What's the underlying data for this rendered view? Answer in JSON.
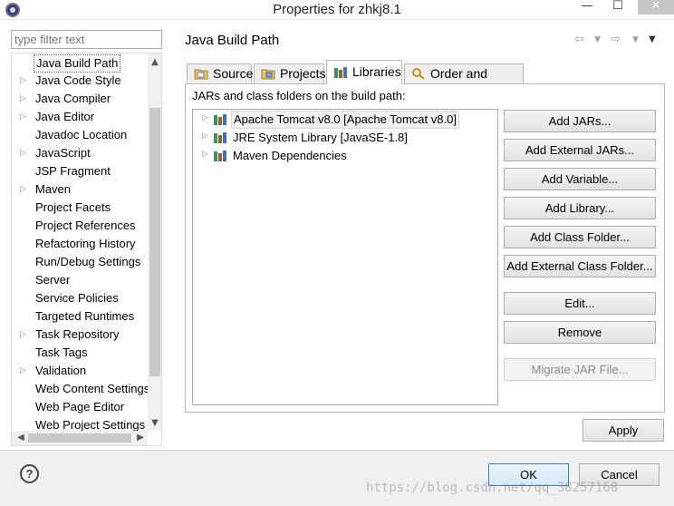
{
  "window": {
    "title": "Properties for zhkj8.1",
    "minimize_glyph": "—",
    "maximize_glyph": "☐",
    "close_glyph": "✕"
  },
  "filter": {
    "placeholder": "type filter text"
  },
  "tree": {
    "items": [
      {
        "label": "Java Build Path",
        "expandable": false,
        "selected": true
      },
      {
        "label": "Java Code Style",
        "expandable": true
      },
      {
        "label": "Java Compiler",
        "expandable": true
      },
      {
        "label": "Java Editor",
        "expandable": true
      },
      {
        "label": "Javadoc Location",
        "expandable": false
      },
      {
        "label": "JavaScript",
        "expandable": true
      },
      {
        "label": "JSP Fragment",
        "expandable": false
      },
      {
        "label": "Maven",
        "expandable": true
      },
      {
        "label": "Project Facets",
        "expandable": false
      },
      {
        "label": "Project References",
        "expandable": false
      },
      {
        "label": "Refactoring History",
        "expandable": false
      },
      {
        "label": "Run/Debug Settings",
        "expandable": false
      },
      {
        "label": "Server",
        "expandable": false
      },
      {
        "label": "Service Policies",
        "expandable": false
      },
      {
        "label": "Targeted Runtimes",
        "expandable": false
      },
      {
        "label": "Task Repository",
        "expandable": true
      },
      {
        "label": "Task Tags",
        "expandable": false
      },
      {
        "label": "Validation",
        "expandable": true
      },
      {
        "label": "Web Content Settings",
        "expandable": false
      },
      {
        "label": "Web Page Editor",
        "expandable": false
      },
      {
        "label": "Web Project Settings",
        "expandable": false
      }
    ]
  },
  "page": {
    "title": "Java Build Path"
  },
  "tabs": [
    {
      "label": "Source",
      "icon": "source-folder-icon",
      "active": false
    },
    {
      "label": "Projects",
      "icon": "projects-icon",
      "active": false
    },
    {
      "label": "Libraries",
      "icon": "libraries-icon",
      "active": true
    },
    {
      "label": "Order and Export",
      "icon": "order-export-icon",
      "active": false
    }
  ],
  "libraries": {
    "section_label": "JARs and class folders on the build path:",
    "items": [
      {
        "label": "Apache Tomcat v8.0 [Apache Tomcat v8.0]",
        "selected": true
      },
      {
        "label": "JRE System Library [JavaSE-1.8]",
        "selected": false
      },
      {
        "label": "Maven Dependencies",
        "selected": false
      }
    ]
  },
  "buttons": [
    {
      "label": "Add JARs...",
      "disabled": false
    },
    {
      "label": "Add External JARs...",
      "disabled": false
    },
    {
      "label": "Add Variable...",
      "disabled": false
    },
    {
      "label": "Add Library...",
      "disabled": false
    },
    {
      "label": "Add Class Folder...",
      "disabled": false
    },
    {
      "label": "Add External Class Folder...",
      "disabled": false
    },
    {
      "label": "Edit...",
      "disabled": false
    },
    {
      "label": "Remove",
      "disabled": false
    },
    {
      "label": "Migrate JAR File...",
      "disabled": true
    }
  ],
  "footer": {
    "apply": "Apply",
    "ok": "OK",
    "cancel": "Cancel",
    "help": "?",
    "watermark": "https://blog.csdn.net/qq_38257168"
  },
  "colors": {
    "ok_border": "#3c7fb1",
    "library_icon_green": "#3f8f5a",
    "library_icon_brown": "#8a6a2a"
  }
}
